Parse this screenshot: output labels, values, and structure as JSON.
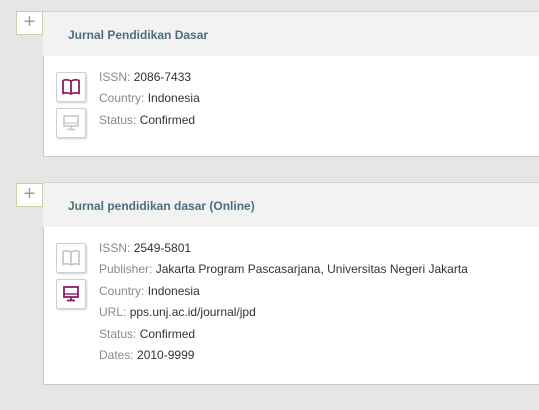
{
  "records": [
    {
      "title": "Jurnal Pendidikan Dasar",
      "fields": [
        {
          "label": "ISSN:",
          "value": "2086-7433"
        },
        {
          "label": "Country:",
          "value": "Indonesia"
        },
        {
          "label": "Status:",
          "value": "Confirmed"
        }
      ],
      "icons": [
        {
          "name": "print-book-icon",
          "active": true
        },
        {
          "name": "online-monitor-icon",
          "active": false
        }
      ]
    },
    {
      "title": "Jurnal pendidikan dasar (Online)",
      "fields": [
        {
          "label": "ISSN:",
          "value": "2549-5801"
        },
        {
          "label": "Publisher:",
          "value": "Jakarta Program Pascasarjana, Universitas Negeri Jakarta"
        },
        {
          "label": "Country:",
          "value": "Indonesia"
        },
        {
          "label": "URL:",
          "value": "pps.unj.ac.id/journal/jpd"
        },
        {
          "label": "Status:",
          "value": "Confirmed"
        },
        {
          "label": "Dates:",
          "value": "2010-9999"
        }
      ],
      "icons": [
        {
          "name": "print-book-icon",
          "active": false
        },
        {
          "name": "online-monitor-icon",
          "active": true
        }
      ]
    }
  ],
  "expand_symbol": "+",
  "colors": {
    "active_icon": "#8b1f5e",
    "inactive_icon": "#c8c8c8",
    "title": "#4a6f80"
  }
}
